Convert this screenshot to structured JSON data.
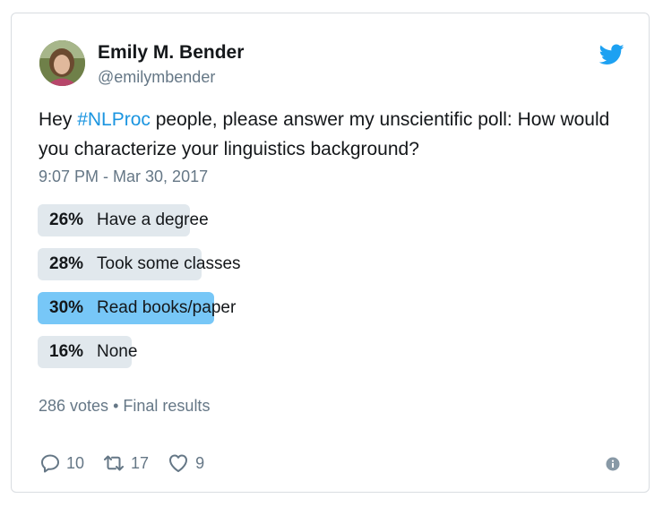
{
  "author": {
    "name": "Emily M. Bender",
    "handle": "@emilymbender"
  },
  "tweet": {
    "text_before": "Hey ",
    "hashtag": "#NLProc",
    "text_after": " people, please answer my unscientific poll: How would you characterize your linguistics background?",
    "timestamp": "9:07 PM - Mar 30, 2017"
  },
  "poll": {
    "options": [
      {
        "percent_label": "26%",
        "label": "Have a degree",
        "fraction": 0.26,
        "winner": false
      },
      {
        "percent_label": "28%",
        "label": "Took some classes",
        "fraction": 0.28,
        "winner": false
      },
      {
        "percent_label": "30%",
        "label": "Read books/paper",
        "fraction": 0.3,
        "winner": true
      },
      {
        "percent_label": "16%",
        "label": "None",
        "fraction": 0.16,
        "winner": false
      }
    ],
    "votes": "286 votes",
    "separator": "•",
    "status": "Final results"
  },
  "actions": {
    "reply_count": "10",
    "retweet_count": "17",
    "like_count": "9"
  },
  "colors": {
    "brand_blue": "#1da1f2",
    "link_blue": "#1b95e0",
    "bar_gray": "#e1e8ed",
    "bar_winner": "#77c7f7",
    "muted_text": "#657786"
  },
  "icons": {
    "brand": "twitter-bird-icon",
    "reply": "reply-icon",
    "retweet": "retweet-icon",
    "like": "heart-icon",
    "info": "info-icon"
  }
}
